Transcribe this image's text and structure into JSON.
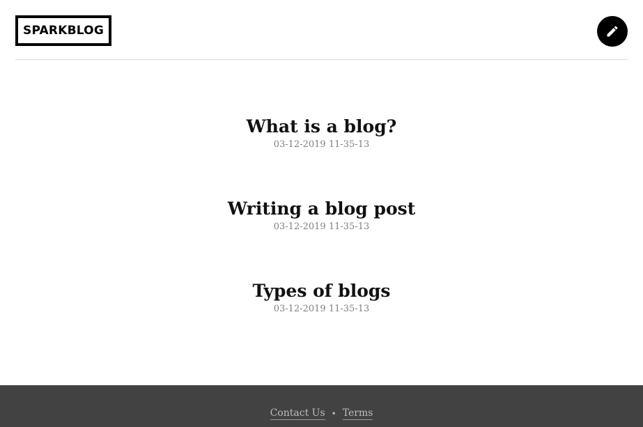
{
  "header": {
    "logo_text": "SPARKBLOG",
    "edit_icon": "pencil-icon"
  },
  "posts": [
    {
      "title": "What is a blog?",
      "date": "03-12-2019 11-35-13"
    },
    {
      "title": "Writing a blog post",
      "date": "03-12-2019 11-35-13"
    },
    {
      "title": "Types of blogs",
      "date": "03-12-2019 11-35-13"
    }
  ],
  "footer": {
    "links": [
      "Contact Us",
      "Terms"
    ],
    "separator": "•"
  },
  "colors": {
    "footer_bg": "#424242",
    "date_text": "#808080",
    "accent": "#000000"
  }
}
